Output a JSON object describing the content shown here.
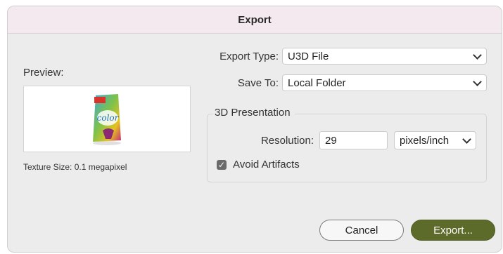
{
  "dialog": {
    "title": "Export"
  },
  "preview": {
    "label": "Preview:",
    "thumbnail_text": "color",
    "texture_size": "Texture Size: 0.1 megapixel"
  },
  "export_type": {
    "label": "Export Type:",
    "value": "U3D File"
  },
  "save_to": {
    "label": "Save To:",
    "value": "Local Folder"
  },
  "presentation": {
    "title": "3D Presentation",
    "resolution_label": "Resolution:",
    "resolution_value": "29",
    "unit_value": "pixels/inch",
    "avoid_artifacts_label": "Avoid Artifacts",
    "avoid_artifacts_checked": true
  },
  "buttons": {
    "cancel": "Cancel",
    "export": "Export..."
  },
  "colors": {
    "accent": "#5c6b2a",
    "titlebar": "#f3e9ee",
    "background": "#ececec"
  }
}
